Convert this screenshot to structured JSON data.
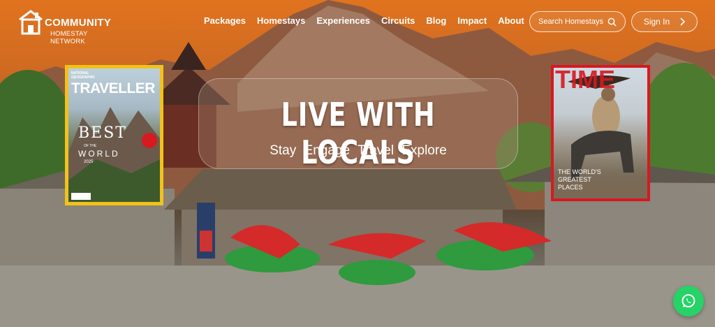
{
  "header": {
    "logo": {
      "title": "COMMUNITY",
      "subtitle": "HOMESTAY NETWORK"
    },
    "nav": [
      "Packages",
      "Homestays",
      "Experiences",
      "Circuits",
      "Blog",
      "Impact",
      "About"
    ],
    "search_label": "Search Homestays",
    "signin_label": "Sign In"
  },
  "hero": {
    "headline": "LIVE WITH LOCALS",
    "tagline": "Stay  Engage  Travel  Explore"
  },
  "magazine_left": {
    "brand": "NATIONAL GEOGRAPHIC",
    "title": "TRAVELLER",
    "feature_1": "BEST",
    "feature_2": "OF THE",
    "feature_3": "WORLD",
    "year": "2025"
  },
  "magazine_right": {
    "title": "TIME",
    "feature_1": "THE WORLD'S",
    "feature_2": "GREATEST",
    "feature_3": "PLACES"
  },
  "colors": {
    "accent_orange": "#e0731e",
    "whatsapp": "#25d366",
    "mag_yellow": "#f2c21b",
    "mag_red": "#d71920"
  },
  "icons": {
    "search": "search-icon",
    "chevron": "chevron-right-icon",
    "whatsapp": "whatsapp-icon"
  }
}
